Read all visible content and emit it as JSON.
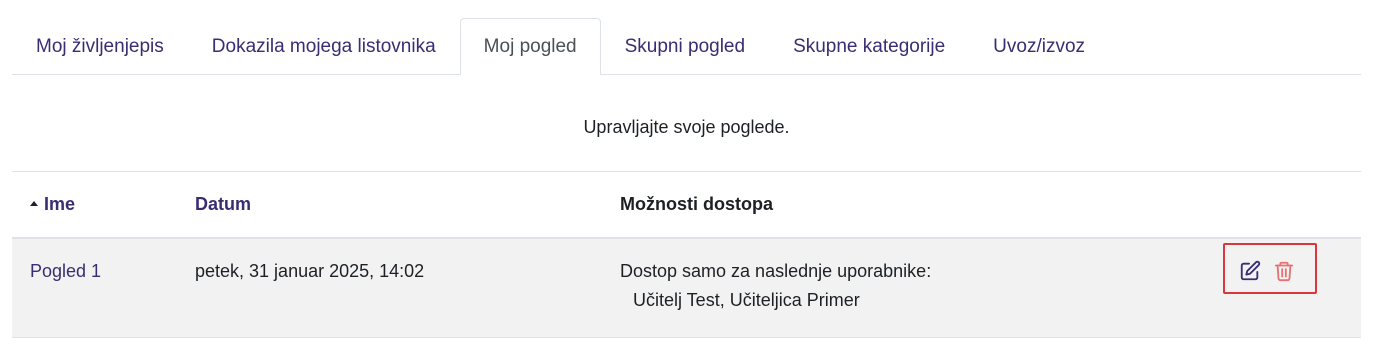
{
  "tabs": [
    {
      "label": "Moj življenjepis",
      "active": false
    },
    {
      "label": "Dokazila mojega listovnika",
      "active": false
    },
    {
      "label": "Moj pogled",
      "active": true
    },
    {
      "label": "Skupni pogled",
      "active": false
    },
    {
      "label": "Skupne kategorije",
      "active": false
    },
    {
      "label": "Uvoz/izvoz",
      "active": false
    }
  ],
  "intro_text": "Upravljajte svoje poglede.",
  "table": {
    "headers": {
      "name": "Ime",
      "date": "Datum",
      "access": "Možnosti dostopa"
    },
    "sort": {
      "column": "name",
      "direction": "asc"
    },
    "rows": [
      {
        "name": "Pogled 1",
        "date": "petek, 31 januar 2025, 14:02",
        "access_label": "Dostop samo za naslednje uporabnike:",
        "access_users": "Učitelj Test, Učiteljica Primer",
        "actions": [
          {
            "icon": "edit-icon",
            "color": "#3a2d72"
          },
          {
            "icon": "trash-icon",
            "color": "#e57373"
          }
        ]
      }
    ]
  },
  "colors": {
    "link": "#3a2d72",
    "highlight_box": "#d9363e",
    "row_bg": "#f2f2f2"
  }
}
